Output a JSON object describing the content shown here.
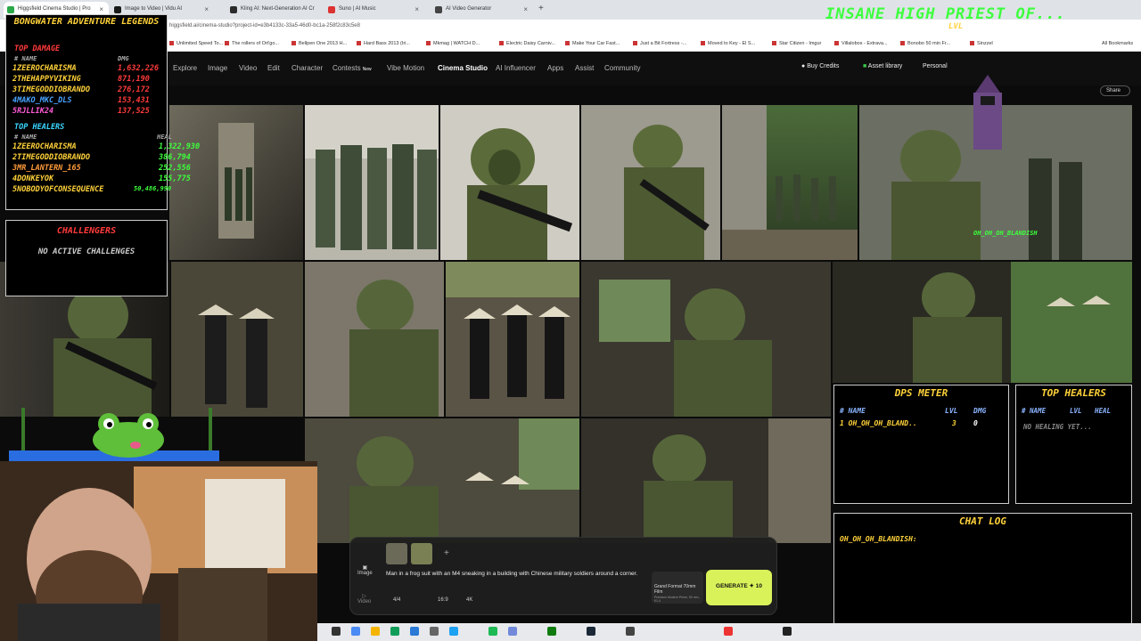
{
  "browser": {
    "tabs": [
      {
        "label": "Higgsfield Cinema Studio | Pro",
        "active": true,
        "color": "#2aa84a"
      },
      {
        "label": "Image to Video | Vidu AI",
        "color": "#1a1a1a"
      },
      {
        "label": "Kling AI: Next-Generation AI Cr",
        "color": "#2b2b2b"
      },
      {
        "label": "Suno | AI Music",
        "color": "#d33"
      },
      {
        "label": "AI Video Generator",
        "color": "#444"
      }
    ],
    "new_tab": "+",
    "url": "higgsfield.ai/cinema-studio?project-id=e3b4133c-33a5-46d0-bc1a-258f2c83c5e8",
    "bookmarks": [
      "Unlimited Speed To...",
      "The rollers of Ort'go...",
      "Bellpen One 2013 H...",
      "Hard Bass 2013 (Iri...",
      "Mkmag | WATCH D...",
      "Electric Daisy Carniv...",
      "Make Your Car Fast...",
      "Just a Bit Fortress -...",
      "Moved to Key - El S...",
      "Star Citizen - Imgur",
      "Villalobos - Extrava...",
      "Bonobo 50 min Fr...",
      "Sinzzel"
    ],
    "all_bookmarks": "All Bookmarks"
  },
  "app": {
    "nav": [
      "Explore",
      "Image",
      "Video",
      "Edit",
      "Character",
      "Contests",
      "Vibe Motion",
      "Cinema Studio",
      "AI Influencer",
      "Apps",
      "Assist",
      "Community"
    ],
    "new_badge": "New",
    "active_nav": "Cinema Studio",
    "buy_credits": "Buy Credits",
    "asset_library": "Asset library",
    "workspace": "Personal",
    "share": "Share"
  },
  "prompt": {
    "text": "Man in a frog suit with an M4 sneaking in a building with Chinese military soldiers around a corner.",
    "mode_image": "Image",
    "mode_video": "Video",
    "count": "4/4",
    "ratio": "16:9",
    "quality": "4K",
    "style_title": "Grand Format 70mm Film",
    "style_sub": "Premium Modern Prime, 50 mm, f/1.4",
    "generate": "GENERATE",
    "cost": "10",
    "add": "+"
  },
  "overlay": {
    "marquee": "INSANE HIGH PRIEST OF...",
    "lvl": "LVL",
    "legends_title": "BONGWATER ADVENTURE LEGENDS",
    "top_damage": "TOP DAMAGE",
    "top_damage_header": {
      "name": "# NAME",
      "dmg": "DMG"
    },
    "top_damage_rows": [
      {
        "rank": "1",
        "name": "ZEEROCHARISMA",
        "value": "1,632,226",
        "color": "#ffd23a"
      },
      {
        "rank": "2",
        "name": "THEHAPPYVIKING",
        "value": "871,190",
        "color": "#ffd23a"
      },
      {
        "rank": "3",
        "name": "TIMEGODDIOBRANDO",
        "value": "276,172",
        "color": "#ffd23a"
      },
      {
        "rank": "4",
        "name": "MAKO_MKC_DLS",
        "value": "153,431",
        "color": "#4aa3ff"
      },
      {
        "rank": "5",
        "name": "RJLLIK24",
        "value": "137,525",
        "color": "#ff5ad6"
      }
    ],
    "top_healers": "TOP HEALERS",
    "top_healers_header": {
      "name": "# NAME",
      "heal": "HEAL"
    },
    "top_healer_rows": [
      {
        "rank": "1",
        "name": "ZEEROCHARISMA",
        "value": "1,322,930",
        "color": "#ffd23a"
      },
      {
        "rank": "2",
        "name": "TIMEGODDIOBRANDO",
        "value": "386,794",
        "color": "#ffd23a"
      },
      {
        "rank": "3",
        "name": "MR_LANTERN_165",
        "value": "252,556",
        "color": "#ff9a3a"
      },
      {
        "rank": "4",
        "name": "DONKEYOK",
        "value": "155,775",
        "color": "#ffd23a"
      },
      {
        "rank": "5",
        "name": "NOBODYOFCONSEQUENCE",
        "value": "50,486,990",
        "color": "#ffd23a"
      }
    ],
    "challengers_title": "CHALLENGERS",
    "challengers_empty": "NO ACTIVE CHALLENGES",
    "player_tag": "OH_OH_OH_BLANDISH",
    "dps_title": "DPS METER",
    "dps_header": {
      "name": "# NAME",
      "lvl": "LVL",
      "dmg": "DMG"
    },
    "dps_rows": [
      {
        "rank": "1",
        "name": "OH_OH_OH_BLAND..",
        "lvl": "3",
        "dmg": "0"
      }
    ],
    "heal_title": "TOP HEALERS",
    "heal_header": {
      "name": "# NAME",
      "lvl": "LVL",
      "heal": "HEAL"
    },
    "heal_empty": "NO HEALING YET...",
    "chat_title": "CHAT LOG",
    "chat_lines": [
      "OH_OH_OH_BLANDISH:"
    ]
  },
  "colors": {
    "accent": "#d9f25a",
    "overlay_gold": "#ffd23a",
    "overlay_red": "#ff3a3a",
    "overlay_cyan": "#3ad6ff"
  }
}
